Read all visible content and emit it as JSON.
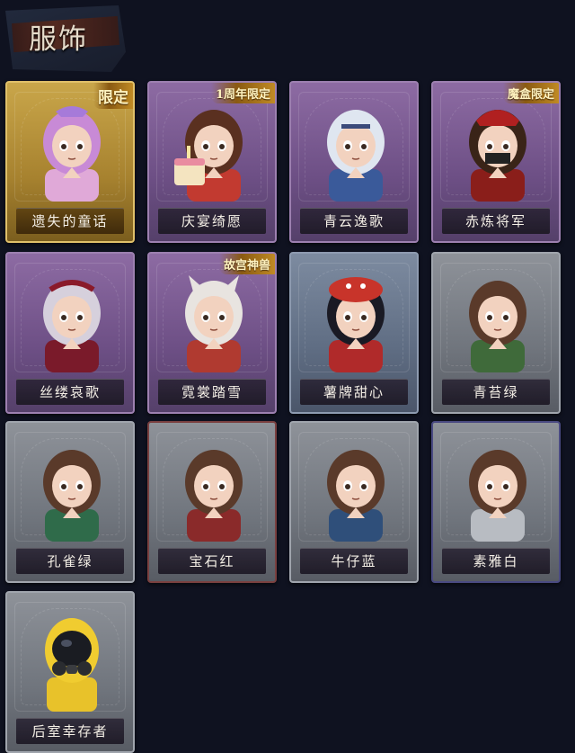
{
  "header": {
    "title": "服饰"
  },
  "costumes": [
    {
      "name": "遗失的童话",
      "badge": "限定",
      "frame": "gold",
      "icon": "fairy-princess-portrait"
    },
    {
      "name": "庆宴绮愿",
      "badge": "1周年限定",
      "frame": "purple",
      "icon": "birthday-cake-portrait"
    },
    {
      "name": "青云逸歌",
      "badge": "",
      "frame": "purple",
      "icon": "silver-hair-portrait"
    },
    {
      "name": "赤炼将军",
      "badge": "魔盒限定",
      "frame": "purple",
      "icon": "masked-general-portrait"
    },
    {
      "name": "丝缕哀歌",
      "badge": "",
      "frame": "purple",
      "icon": "gothic-doll-portrait"
    },
    {
      "name": "霓裳踏雪",
      "badge": "故宫神兽",
      "frame": "purple",
      "icon": "wolf-ears-portrait"
    },
    {
      "name": "薯牌甜心",
      "badge": "",
      "frame": "blue",
      "icon": "red-hat-portrait"
    },
    {
      "name": "青苔绿",
      "badge": "",
      "frame": "gray",
      "icon": "green-outfit-portrait",
      "accent": "#3f6a3a"
    },
    {
      "name": "孔雀绿",
      "badge": "",
      "frame": "gray",
      "icon": "peacock-green-portrait",
      "accent": "#2f6b4a"
    },
    {
      "name": "宝石红",
      "badge": "",
      "frame": "gray",
      "icon": "ruby-red-portrait",
      "accent": "#8a2a2a"
    },
    {
      "name": "牛仔蓝",
      "badge": "",
      "frame": "gray",
      "icon": "denim-blue-portrait",
      "accent": "#2f4f7a"
    },
    {
      "name": "素雅白",
      "badge": "",
      "frame": "gray",
      "icon": "plain-white-portrait",
      "accent": "#b8bcc2"
    },
    {
      "name": "后室幸存者",
      "badge": "",
      "frame": "gray",
      "icon": "gas-mask-survivor-portrait"
    }
  ]
}
